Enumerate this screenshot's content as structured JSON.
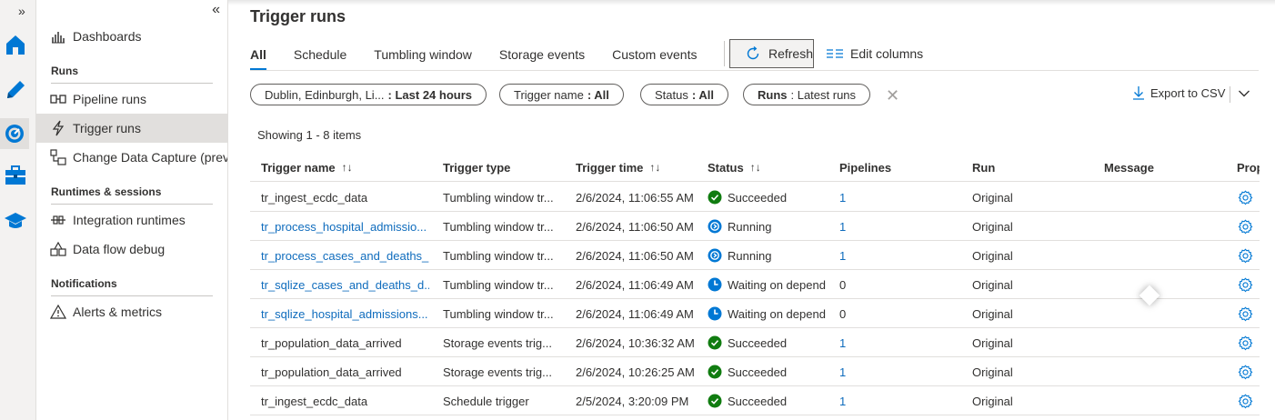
{
  "rail": {
    "expand_glyph": "»",
    "icons": [
      "home-icon",
      "pencil-author-icon",
      "monitor-gauge-icon",
      "manage-toolbox-icon",
      "learning-hat-icon"
    ]
  },
  "nav": {
    "collapse_glyph": "«",
    "dashboards": "Dashboards",
    "runs_heading": "Runs",
    "pipeline_runs": "Pipeline runs",
    "trigger_runs": "Trigger runs",
    "cdc": "Change Data Capture (previ...",
    "runtimes_heading": "Runtimes & sessions",
    "integration_runtimes": "Integration runtimes",
    "data_flow_debug": "Data flow debug",
    "notifications_heading": "Notifications",
    "alerts_metrics": "Alerts & metrics"
  },
  "page": {
    "title": "Trigger runs",
    "tabs": [
      "All",
      "Schedule",
      "Tumbling window",
      "Storage events",
      "Custom events"
    ],
    "refresh": "Refresh",
    "edit_columns": "Edit columns",
    "filters": {
      "timezone_label": "Dublin, Edinburgh, Li...",
      "timezone_value": ": Last 24 hours",
      "trigger_name_label": "Trigger name",
      "trigger_name_value": ": All",
      "status_label": "Status",
      "status_value": ": All",
      "runs_label": "Runs",
      "runs_value": ": Latest runs"
    },
    "export": "Export to CSV",
    "showing": "Showing 1 - 8 items"
  },
  "table": {
    "headers": {
      "trigger_name": "Trigger name",
      "trigger_type": "Trigger type",
      "trigger_time": "Trigger time",
      "status": "Status",
      "pipelines": "Pipelines",
      "run": "Run",
      "message": "Message",
      "properties": "Prop"
    },
    "sort_glyph": "↑↓",
    "rows": [
      {
        "name": "tr_ingest_ecdc_data",
        "type": "Tumbling window tr...",
        "time": "2/6/2024, 11:06:55 AM",
        "status": "Succeeded",
        "pipelines": "1",
        "run": "Original"
      },
      {
        "name": "tr_process_hospital_admissio...",
        "type": "Tumbling window tr...",
        "time": "2/6/2024, 11:06:50 AM",
        "status": "Running",
        "pipelines": "1",
        "run": "Original"
      },
      {
        "name": "tr_process_cases_and_deaths_...",
        "type": "Tumbling window tr...",
        "time": "2/6/2024, 11:06:50 AM",
        "status": "Running",
        "pipelines": "1",
        "run": "Original"
      },
      {
        "name": "tr_sqlize_cases_and_deaths_d...",
        "type": "Tumbling window tr...",
        "time": "2/6/2024, 11:06:49 AM",
        "status": "Waiting on depend",
        "pipelines": "0",
        "run": "Original"
      },
      {
        "name": "tr_sqlize_hospital_admissions...",
        "type": "Tumbling window tr...",
        "time": "2/6/2024, 11:06:49 AM",
        "status": "Waiting on depend",
        "pipelines": "0",
        "run": "Original"
      },
      {
        "name": "tr_population_data_arrived",
        "type": "Storage events trig...",
        "time": "2/6/2024, 10:36:32 AM",
        "status": "Succeeded",
        "pipelines": "1",
        "run": "Original"
      },
      {
        "name": "tr_population_data_arrived",
        "type": "Storage events trig...",
        "time": "2/6/2024, 10:26:25 AM",
        "status": "Succeeded",
        "pipelines": "1",
        "run": "Original"
      },
      {
        "name": "tr_ingest_ecdc_data",
        "type": "Schedule trigger",
        "time": "2/5/2024, 3:20:09 PM",
        "status": "Succeeded",
        "pipelines": "1",
        "run": "Original"
      }
    ]
  },
  "colors": {
    "accent": "#0078d4",
    "link": "#0f6cbd",
    "success": "#107c10",
    "running": "#0078d4"
  }
}
